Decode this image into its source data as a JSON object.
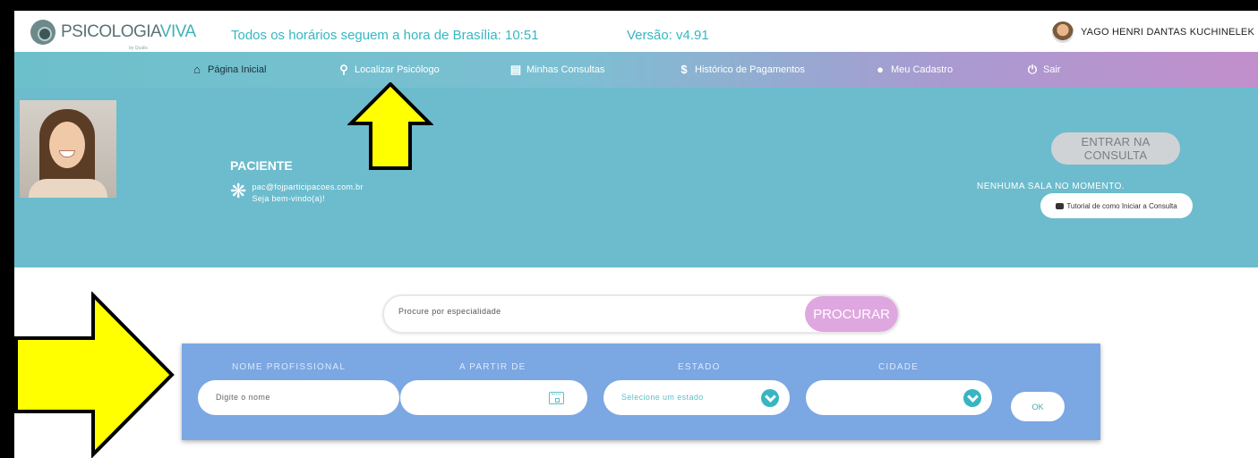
{
  "header": {
    "logo_text_a": "PSICOLOGIA",
    "logo_text_b": "VIVA",
    "logo_tagline": "by Qualis",
    "timezone_notice": "Todos os horários seguem a hora de Brasília: 10:51",
    "version": "Versão: v4.91",
    "user_name": "YAGO HENRI DANTAS KUCHINELEK"
  },
  "nav": {
    "items": [
      {
        "label": "Página Inicial",
        "icon": "home-icon"
      },
      {
        "label": "Localizar Psicólogo",
        "icon": "map-pin-icon"
      },
      {
        "label": "Minhas Consultas",
        "icon": "calendar-list-icon"
      },
      {
        "label": "Histórico de Pagamentos",
        "icon": "dollar-icon"
      },
      {
        "label": "Meu Cadastro",
        "icon": "user-icon"
      },
      {
        "label": "Sair",
        "icon": "power-icon"
      }
    ]
  },
  "profile": {
    "role": "PACIENTE",
    "email": "pac@fojparticipacoes.com.br",
    "welcome": "Seja bem-vindo(a)!"
  },
  "consultation": {
    "enter_label": "ENTRAR NA CONSULTA",
    "status": "NENHUMA SALA NO MOMENTO.",
    "tutorial_label": "Tutorial de como Iniciar a Consulta"
  },
  "search": {
    "placeholder": "Procure por especialidade",
    "button_label": "PROCURAR"
  },
  "filters": {
    "name_label": "NOME PROFISSIONAL",
    "name_placeholder": "Digite o nome",
    "date_label": "A PARTIR DE",
    "state_label": "ESTADO",
    "state_placeholder": "Selecione um estado",
    "city_label": "CIDADE",
    "ok_label": "OK"
  },
  "colors": {
    "accent_teal": "#36b7c4",
    "hero_bg": "#6cbccd",
    "filter_bg": "#7ba7e3",
    "search_button": "#dfa7e0",
    "annotation_arrow": "#ffff00"
  }
}
